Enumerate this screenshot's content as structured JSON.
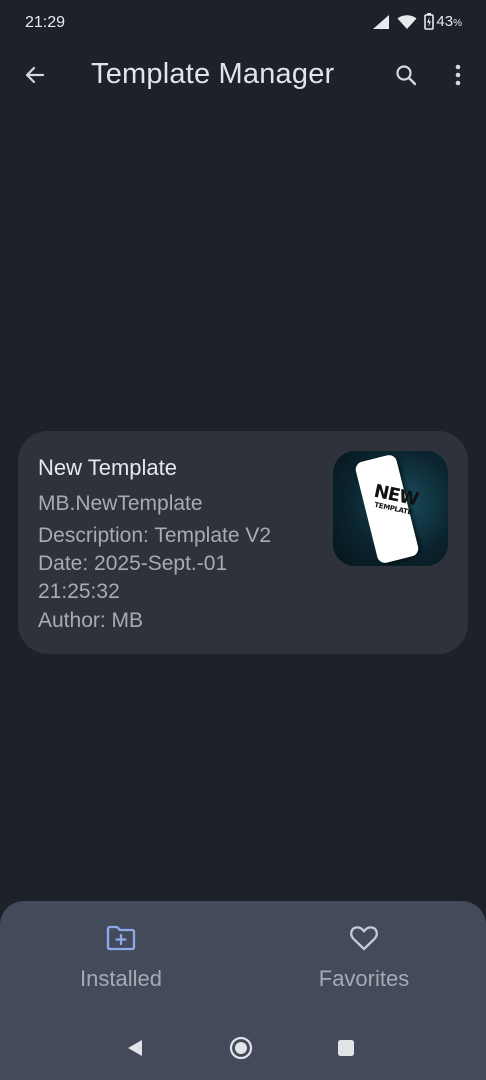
{
  "status_bar": {
    "time": "21:29",
    "battery_percent": "43",
    "battery_unit": "%",
    "icons": [
      "signal-icon",
      "wifi-icon",
      "battery-icon"
    ]
  },
  "app_bar": {
    "title": "Template Manager",
    "icons": [
      "back-arrow-icon",
      "search-icon",
      "more-vert-icon"
    ]
  },
  "templates": [
    {
      "name": "New Template",
      "id": "MB.NewTemplate",
      "description": "Description: Template V2",
      "date_line1": "Date: 2025-Sept.-01",
      "date_line2": "21:25:32",
      "author": "Author: MB",
      "thumbnail_text_big": "NEW",
      "thumbnail_text_small": "TEMPLATE"
    }
  ],
  "bottom_nav": {
    "items": [
      {
        "label": "Installed",
        "icon": "folder-add-icon",
        "selected": true
      },
      {
        "label": "Favorites",
        "icon": "heart-outline-icon",
        "selected": false
      }
    ]
  },
  "colors": {
    "background": "#1d2129",
    "card": "#2e323a",
    "bottom_nav": "#434a5a",
    "accent_icon": "#8fa8e8",
    "secondary_text": "#a9abb2"
  }
}
